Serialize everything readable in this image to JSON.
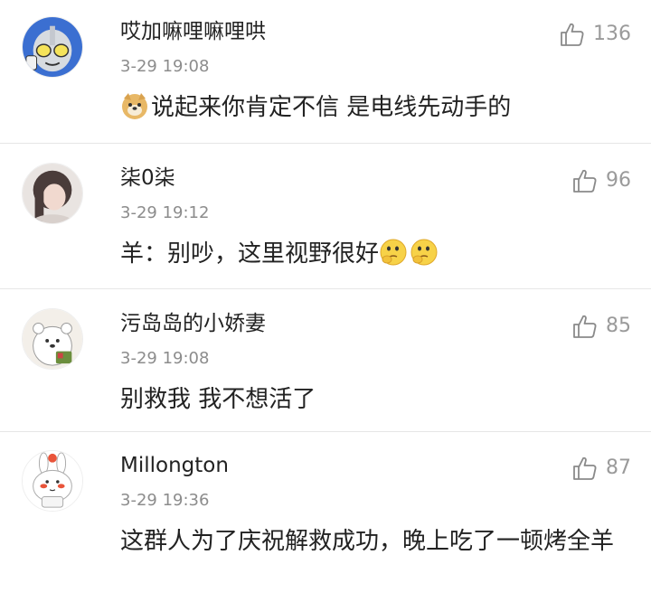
{
  "comments": [
    {
      "username": "哎加嘛哩嘛哩哄",
      "time": "3-29 19:08",
      "likes": "136",
      "text": "说起来你肯定不信 是电线先动手的",
      "emojis_before": [
        "doge-emoji"
      ],
      "emojis_after": []
    },
    {
      "username": "柒0柒",
      "time": "3-29 19:12",
      "likes": "96",
      "text": "羊：别吵，这里视野很好",
      "emojis_before": [],
      "emojis_after": [
        "hmm-face-emoji",
        "hmm-face-emoji"
      ]
    },
    {
      "username": "污岛岛的小娇妻",
      "time": "3-29 19:08",
      "likes": "85",
      "text": "别救我 我不想活了",
      "emojis_before": [],
      "emojis_after": []
    },
    {
      "username": "Millongton",
      "time": "3-29 19:36",
      "likes": "87",
      "text": "这群人为了庆祝解救成功，晚上吃了一顿烤全羊",
      "emojis_before": [],
      "emojis_after": []
    }
  ],
  "icons": {
    "like": "thumbs-up-icon"
  },
  "colors": {
    "username": "#222222",
    "timestamp": "#8c8c8c",
    "like_count": "#9a9a9a",
    "divider": "#e6e6e6"
  }
}
